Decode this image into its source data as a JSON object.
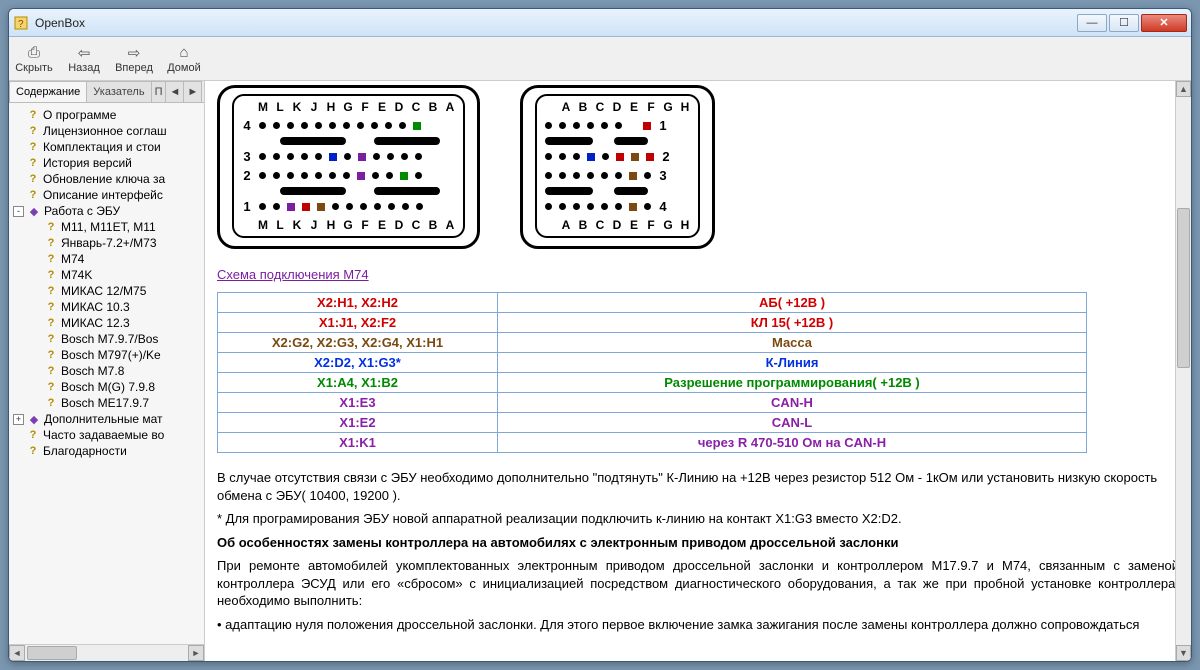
{
  "window": {
    "title": "OpenBox"
  },
  "toolbar": {
    "hide": "Скрыть",
    "back": "Назад",
    "forward": "Вперед",
    "home": "Домой"
  },
  "tabs": {
    "contents": "Содержание",
    "index": "Указатель",
    "search": "П",
    "nav1": "◄",
    "nav2": "►"
  },
  "tree": {
    "items": [
      {
        "lvl": 1,
        "ico": "q",
        "label": "О программе"
      },
      {
        "lvl": 1,
        "ico": "q",
        "label": "Лицензионное соглаш"
      },
      {
        "lvl": 1,
        "ico": "q",
        "label": "Комплектация и стои"
      },
      {
        "lvl": 1,
        "ico": "q",
        "label": "История версий"
      },
      {
        "lvl": 1,
        "ico": "q",
        "label": "Обновление ключа за"
      },
      {
        "lvl": 1,
        "ico": "q",
        "label": "Описание интерфейс"
      },
      {
        "lvl": 0,
        "ico": "b",
        "label": "Работа с ЭБУ",
        "exp": "-"
      },
      {
        "lvl": 2,
        "ico": "q",
        "label": "М11, М11ЕТ, М11"
      },
      {
        "lvl": 2,
        "ico": "q",
        "label": "Январь-7.2+/М73"
      },
      {
        "lvl": 2,
        "ico": "q",
        "label": "М74"
      },
      {
        "lvl": 2,
        "ico": "q",
        "label": "М74K"
      },
      {
        "lvl": 2,
        "ico": "q",
        "label": "МИКАС 12/М75"
      },
      {
        "lvl": 2,
        "ico": "q",
        "label": "МИКАС 10.3"
      },
      {
        "lvl": 2,
        "ico": "q",
        "label": "МИКАС 12.3"
      },
      {
        "lvl": 2,
        "ico": "q",
        "label": "Bosch M7.9.7/Bos"
      },
      {
        "lvl": 2,
        "ico": "q",
        "label": "Bosch M797(+)/Ke"
      },
      {
        "lvl": 2,
        "ico": "q",
        "label": "Bosch M7.8"
      },
      {
        "lvl": 2,
        "ico": "q",
        "label": "Bosch M(G) 7.9.8"
      },
      {
        "lvl": 2,
        "ico": "q",
        "label": "Bosch ME17.9.7"
      },
      {
        "lvl": 0,
        "ico": "b",
        "label": "Дополнительные мат",
        "exp": "+"
      },
      {
        "lvl": 1,
        "ico": "q",
        "label": "Часто задаваемые во"
      },
      {
        "lvl": 1,
        "ico": "q",
        "label": "Благодарности"
      }
    ]
  },
  "content": {
    "connector1": {
      "top_labels": [
        "M",
        "L",
        "K",
        "J",
        "H",
        "G",
        "F",
        "E",
        "D",
        "C",
        "B",
        "A"
      ],
      "bot_labels": [
        "M",
        "L",
        "K",
        "J",
        "H",
        "G",
        "F",
        "E",
        "D",
        "C",
        "B",
        "A"
      ],
      "row_nums": [
        "4",
        "3",
        "2",
        "1"
      ]
    },
    "connector2": {
      "top_labels": [
        "A",
        "B",
        "C",
        "D",
        "E",
        "F",
        "G",
        "H"
      ],
      "bot_labels": [
        "A",
        "B",
        "C",
        "D",
        "E",
        "F",
        "G",
        "H"
      ],
      "row_nums": [
        "1",
        "2",
        "3",
        "4"
      ]
    },
    "link": "Схема подключения М74",
    "pintable": [
      {
        "pin": "X2:H1, X2:H2",
        "desc": "АБ( +12В )",
        "cls": "c-red"
      },
      {
        "pin": "X1:J1, X2:F2",
        "desc": "КЛ 15( +12В )",
        "cls": "c-red"
      },
      {
        "pin": "X2:G2, X2:G3, X2:G4, X1:H1",
        "desc": "Масса",
        "cls": "c-brown"
      },
      {
        "pin": "X2:D2, X1:G3*",
        "desc": "К-Линия",
        "cls": "c-blue"
      },
      {
        "pin": "X1:A4, X1:B2",
        "desc": "Разрешение программирования( +12В )",
        "cls": "c-green"
      },
      {
        "pin": "X1:E3",
        "desc": "CAN-H",
        "cls": "c-purple"
      },
      {
        "pin": "X1:E2",
        "desc": "CAN-L",
        "cls": "c-purple"
      },
      {
        "pin": "X1:K1",
        "desc": "через R 470-510 Ом на CAN-H",
        "cls": "c-purple"
      }
    ],
    "p1": "В случае отсутствия связи с ЭБУ необходимо дополнительно \"подтянуть\" К-Линию на +12В через резистор 512 Ом - 1кОм или установить низкую скорость обмена с ЭБУ( 10400, 19200 ).",
    "p2": "* Для програмирования ЭБУ новой аппаратной реализации подключить к-линию на контакт X1:G3 вместо X2:D2.",
    "h1": "Об особенностях замены контроллера на автомобилях с электронным приводом дроссельной заслонки",
    "p3": "При ремонте автомобилей укомплектованных электронным приводом дроссельной заслонки и контроллером М17.9.7 и М74, связанным с заменой контроллера ЭСУД или его «сбросом» с инициализацией посредством диагностического оборудования, а так же при пробной установке контроллера, необходимо выполнить:",
    "b1": "адаптацию нуля положения дроссельной заслонки. Для этого первое включение замка зажигания после замены контроллера должно сопровождаться"
  }
}
